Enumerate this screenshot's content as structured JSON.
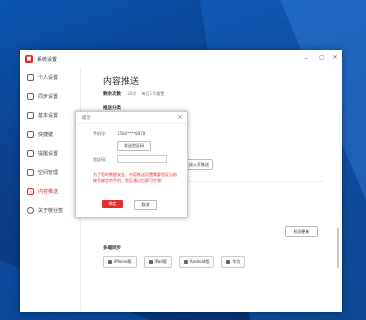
{
  "window": {
    "title": "系统设置",
    "min": "–",
    "max": "▢",
    "close": "✕"
  },
  "sidebar": {
    "items": [
      {
        "label": "个人设置"
      },
      {
        "label": "同步设置"
      },
      {
        "label": "基本设置"
      },
      {
        "label": "快捷键"
      },
      {
        "label": "提醒设置"
      },
      {
        "label": "空间管理"
      },
      {
        "label": "内容推送"
      },
      {
        "label": "关于敬业签"
      }
    ]
  },
  "main": {
    "title": "内容推送",
    "stats_label": "剩余次数",
    "stats_value": "30次",
    "stats_note": "每日1号重置",
    "section": "推送分类",
    "generate_btn": "生成公开推送",
    "check_btn": "检测更新",
    "multi": "多端同步",
    "devices": [
      "iPhone版",
      "iPad版",
      "Android版",
      "华为"
    ]
  },
  "dialog": {
    "title": "提示",
    "phone_label": "手机号:",
    "phone_value": "1584****8978",
    "send_btn": "发送验证码",
    "code_label": "验证码:",
    "warning": "为了您的数据安全，内容推送设置需要验证当前账号绑定的手机，验证通过后即可生效!",
    "ok": "确定",
    "cancel": "取消",
    "close": "×"
  }
}
